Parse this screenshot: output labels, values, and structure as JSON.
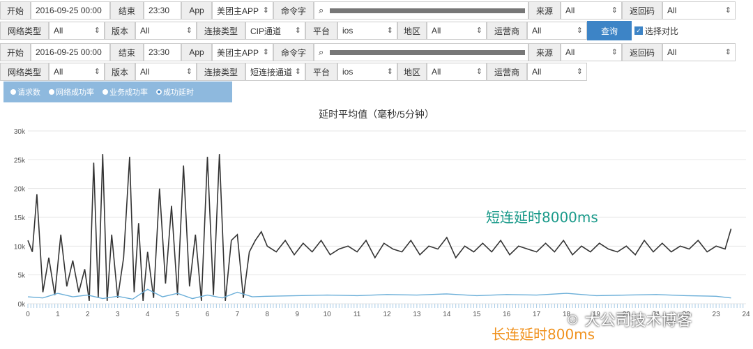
{
  "filter1": {
    "start_label": "开始",
    "start_value": "2016-09-25 00:00",
    "end_label": "结束",
    "end_value": "23:30",
    "app_label": "App",
    "app_value": "美团主APP",
    "cmd_label": "命令字",
    "source_label": "来源",
    "source_value": "All",
    "code_label": "返回码",
    "code_value": "All",
    "net_label": "网络类型",
    "net_value": "All",
    "ver_label": "版本",
    "ver_value": "All",
    "conn_label": "连接类型",
    "conn_value": "CIP通道",
    "platform_label": "平台",
    "platform_value": "ios",
    "region_label": "地区",
    "region_value": "All",
    "carrier_label": "运营商",
    "carrier_value": "All",
    "query_label": "查询",
    "compare_label": "选择对比"
  },
  "filter2": {
    "start_label": "开始",
    "start_value": "2016-09-25 00:00",
    "end_label": "结束",
    "end_value": "23:30",
    "app_label": "App",
    "app_value": "美团主APP",
    "cmd_label": "命令字",
    "source_label": "来源",
    "source_value": "All",
    "code_label": "返回码",
    "code_value": "All",
    "net_label": "网络类型",
    "net_value": "All",
    "ver_label": "版本",
    "ver_value": "All",
    "conn_label": "连接类型",
    "conn_value": "短连接通道",
    "platform_label": "平台",
    "platform_value": "ios",
    "region_label": "地区",
    "region_value": "All",
    "carrier_label": "运营商",
    "carrier_value": "All"
  },
  "metrics": [
    {
      "label": "请求数",
      "selected": false
    },
    {
      "label": "网络成功率",
      "selected": false
    },
    {
      "label": "业务成功率",
      "selected": false
    },
    {
      "label": "成功延时",
      "selected": true
    }
  ],
  "annotations": {
    "short": "短连延时8000ms",
    "long": "长连延时800ms",
    "short_color": "#1a9a8a",
    "long_color": "#f0921e"
  },
  "watermark": "大公司技术博客",
  "chart_data": {
    "type": "line",
    "title": "延时平均值（毫秒/5分钟）",
    "xlim": [
      0,
      24
    ],
    "ylim": [
      0,
      30000
    ],
    "x_ticks": [
      0,
      1,
      2,
      3,
      4,
      5,
      6,
      7,
      8,
      9,
      10,
      11,
      12,
      13,
      14,
      15,
      16,
      17,
      18,
      19,
      20,
      21,
      22,
      23,
      24
    ],
    "y_ticks": [
      "0k",
      "5k",
      "10k",
      "15k",
      "20k",
      "25k",
      "30k"
    ],
    "grid": true,
    "series": [
      {
        "color": "#333333",
        "values_x": [
          0,
          0.15,
          0.3,
          0.5,
          0.7,
          0.9,
          1.1,
          1.3,
          1.5,
          1.7,
          1.9,
          2.05,
          2.2,
          2.35,
          2.5,
          2.65,
          2.8,
          3.0,
          3.2,
          3.4,
          3.55,
          3.7,
          3.85,
          4.0,
          4.2,
          4.4,
          4.6,
          4.8,
          5.0,
          5.2,
          5.4,
          5.6,
          5.8,
          6.0,
          6.2,
          6.4,
          6.6,
          6.8,
          7.0,
          7.2,
          7.4,
          7.6,
          7.8,
          8.0,
          8.3,
          8.6,
          8.9,
          9.2,
          9.5,
          9.8,
          10.1,
          10.4,
          10.7,
          11.0,
          11.3,
          11.6,
          11.9,
          12.2,
          12.5,
          12.8,
          13.1,
          13.4,
          13.7,
          14.0,
          14.3,
          14.6,
          14.9,
          15.2,
          15.5,
          15.8,
          16.1,
          16.4,
          16.7,
          17.0,
          17.3,
          17.6,
          17.9,
          18.2,
          18.5,
          18.8,
          19.1,
          19.4,
          19.7,
          20.0,
          20.3,
          20.6,
          20.9,
          21.2,
          21.5,
          21.8,
          22.1,
          22.4,
          22.7,
          23.0,
          23.3,
          23.5
        ],
        "values_y": [
          11000,
          9000,
          19000,
          2000,
          8000,
          1500,
          12000,
          3000,
          7500,
          2000,
          6000,
          500,
          24500,
          1000,
          26000,
          500,
          12000,
          1000,
          8000,
          25500,
          2000,
          14000,
          500,
          9000,
          1000,
          20000,
          3500,
          17000,
          1500,
          24000,
          3000,
          12000,
          500,
          25500,
          1500,
          26000,
          500,
          11000,
          12000,
          1000,
          9000,
          11000,
          12500,
          10000,
          9000,
          11000,
          8500,
          10500,
          9000,
          11000,
          8500,
          9500,
          10000,
          9000,
          11000,
          8000,
          10500,
          9500,
          9000,
          11000,
          8500,
          10000,
          9500,
          11500,
          8000,
          10000,
          9000,
          10500,
          9000,
          11000,
          8500,
          10000,
          9500,
          9000,
          10500,
          9000,
          11000,
          8500,
          10000,
          9000,
          10500,
          9500,
          9000,
          10000,
          8500,
          11000,
          9000,
          10500,
          9000,
          10000,
          9500,
          11000,
          9000,
          10000,
          9500,
          13000
        ]
      },
      {
        "color": "#6aaed8",
        "values_x": [
          0,
          0.5,
          1,
          1.5,
          2,
          2.5,
          3,
          3.5,
          4,
          4.5,
          5,
          5.5,
          6,
          6.5,
          7,
          7.5,
          8,
          9,
          10,
          11,
          12,
          13,
          14,
          15,
          16,
          17,
          18,
          19,
          20,
          21,
          22,
          23,
          23.5
        ],
        "values_y": [
          1200,
          1000,
          1800,
          1200,
          1500,
          900,
          1300,
          800,
          2500,
          1200,
          1800,
          900,
          1500,
          1000,
          2000,
          1200,
          1300,
          1400,
          1500,
          1400,
          1600,
          1500,
          1700,
          1400,
          1600,
          1500,
          1800,
          1400,
          1500,
          1600,
          1400,
          1300,
          1000
        ]
      }
    ]
  }
}
